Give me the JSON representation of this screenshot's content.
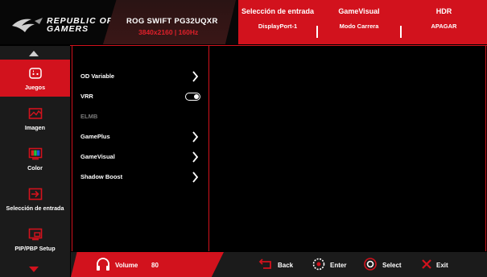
{
  "header": {
    "brand_line1": "REPUBLIC OF",
    "brand_line2": "GAMERS",
    "model": "ROG SWIFT PG32UQXR",
    "resolution": "3840x2160 | 160Hz",
    "columns": [
      {
        "title": "Selección de entrada",
        "value": "DisplayPort-1"
      },
      {
        "title": "GameVisual",
        "value": "Modo Carrera"
      },
      {
        "title": "HDR",
        "value": "APAGAR"
      }
    ]
  },
  "sidebar": {
    "items": [
      {
        "label": "Juegos",
        "icon": "gamepad-icon",
        "active": true
      },
      {
        "label": "Imagen",
        "icon": "image-icon",
        "active": false
      },
      {
        "label": "Color",
        "icon": "color-icon",
        "active": false
      },
      {
        "label": "Selección de entrada",
        "icon": "input-select-icon",
        "active": false
      },
      {
        "label": "PIP/PBP Setup",
        "icon": "pip-pbp-icon",
        "active": false
      }
    ]
  },
  "menu": {
    "items": [
      {
        "label": "OD Variable",
        "control": "chevron",
        "enabled": true
      },
      {
        "label": "VRR",
        "control": "toggle",
        "state": "on",
        "enabled": true
      },
      {
        "label": "ELMB",
        "control": "none",
        "enabled": false
      },
      {
        "label": "GamePlus",
        "control": "chevron",
        "enabled": true
      },
      {
        "label": "GameVisual",
        "control": "chevron",
        "enabled": true
      },
      {
        "label": "Shadow Boost",
        "control": "chevron",
        "enabled": true
      }
    ]
  },
  "footer": {
    "volume_label": "Volume",
    "volume_value": "80",
    "back": "Back",
    "enter": "Enter",
    "select": "Select",
    "exit": "Exit"
  },
  "colors": {
    "accent": "#d2121d",
    "panel": "#1b1b1b",
    "background": "#000000"
  }
}
